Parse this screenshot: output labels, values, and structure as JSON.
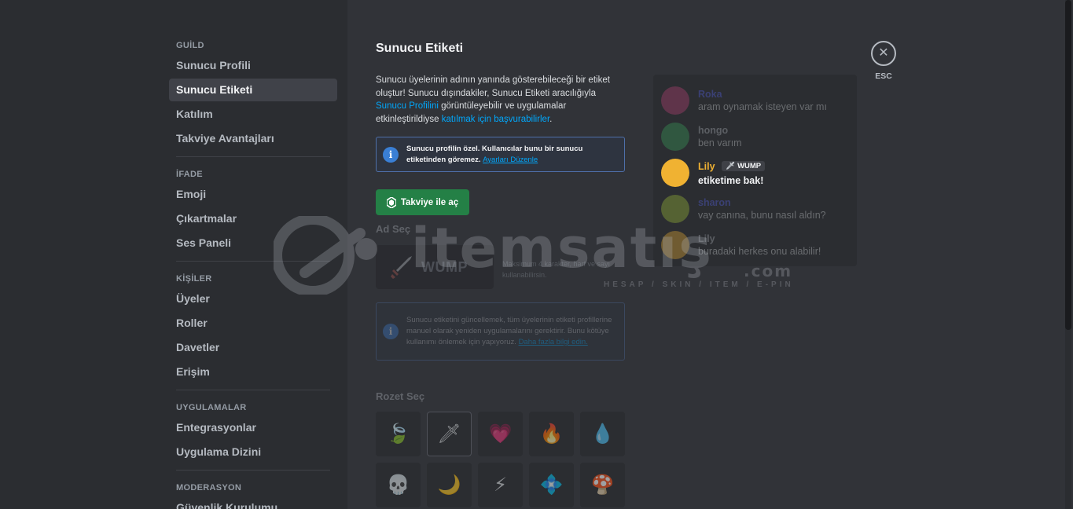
{
  "sidebar": {
    "sections": [
      {
        "header": "GUİLD",
        "items": [
          {
            "label": "Sunucu Profili",
            "active": false
          },
          {
            "label": "Sunucu Etiketi",
            "active": true
          },
          {
            "label": "Katılım",
            "active": false
          },
          {
            "label": "Takviye Avantajları",
            "active": false
          }
        ]
      },
      {
        "header": "İFADE",
        "items": [
          {
            "label": "Emoji"
          },
          {
            "label": "Çıkartmalar"
          },
          {
            "label": "Ses Paneli"
          }
        ]
      },
      {
        "header": "KİŞİLER",
        "items": [
          {
            "label": "Üyeler"
          },
          {
            "label": "Roller"
          },
          {
            "label": "Davetler"
          },
          {
            "label": "Erişim"
          }
        ]
      },
      {
        "header": "UYGULAMALAR",
        "items": [
          {
            "label": "Entegrasyonlar"
          },
          {
            "label": "Uygulama Dizini"
          }
        ]
      },
      {
        "header": "MODERASYON",
        "items": [
          {
            "label": "Güvenlik Kurulumu"
          }
        ]
      }
    ]
  },
  "main": {
    "title": "Sunucu Etiketi",
    "desc_1": "Sunucu üyelerinin adının yanında gösterebileceği bir etiket oluştur! Sunucu dışındakiler, Sunucu Etiketi aracılığıyla ",
    "desc_link_1": "Sunucu Profilini",
    "desc_2": " görüntüleyebilir ve uygulamalar etkinleştirildiyse ",
    "desc_link_2": "katılmak için başvurabilirler",
    "desc_3": ".",
    "info_text": "Sunucu profilin özel. Kullanıcılar bunu bir sunucu etiketinden göremez. ",
    "info_link": "Ayarları Düzenle",
    "boost_button": "Takviye ile aç",
    "name_label": "Ad Seç",
    "name_value": "WUMP",
    "name_hint": "Maksimum 4 karakter, harf ve sayı kullanabilirsin.",
    "warn_text": "Sunucu etiketini güncellemek, tüm üyelerinin etiketi profillerine manuel olarak yeniden uygulamalarını gerektirir. Bunu kötüye kullanımı önlemek için yapıyoruz. ",
    "warn_link": "Daha fazla bilgi edin.",
    "badge_label": "Rozet Seç",
    "badges": [
      "leaf",
      "sword",
      "heart",
      "fire",
      "water",
      "skull",
      "moon",
      "lightning",
      "crystal",
      "mushroom"
    ]
  },
  "preview": {
    "messages": [
      {
        "name": "Roka",
        "text": "aram oynamak isteyen var mı",
        "color": "#5865f2",
        "faded": true
      },
      {
        "name": "hongo",
        "text": "ben varım",
        "color": "#3ba55c",
        "faded": true
      },
      {
        "name": "Lily",
        "text": "etiketime bak!",
        "color": "#f0b232",
        "faded": false,
        "tag": "WUMP"
      },
      {
        "name": "sharon",
        "text": "vay canına, bunu nasıl aldın?",
        "color": "#5865f2",
        "faded": true
      },
      {
        "name": "Lily",
        "text": "buradaki herkes onu alabilir!",
        "color": "#f0b232",
        "faded": true
      }
    ]
  },
  "close": {
    "label": "ESC"
  },
  "watermark": {
    "brand": "itemsatış",
    "domain": ".com",
    "tagline": "HESAP / SKIN / ITEM / E-PIN"
  }
}
